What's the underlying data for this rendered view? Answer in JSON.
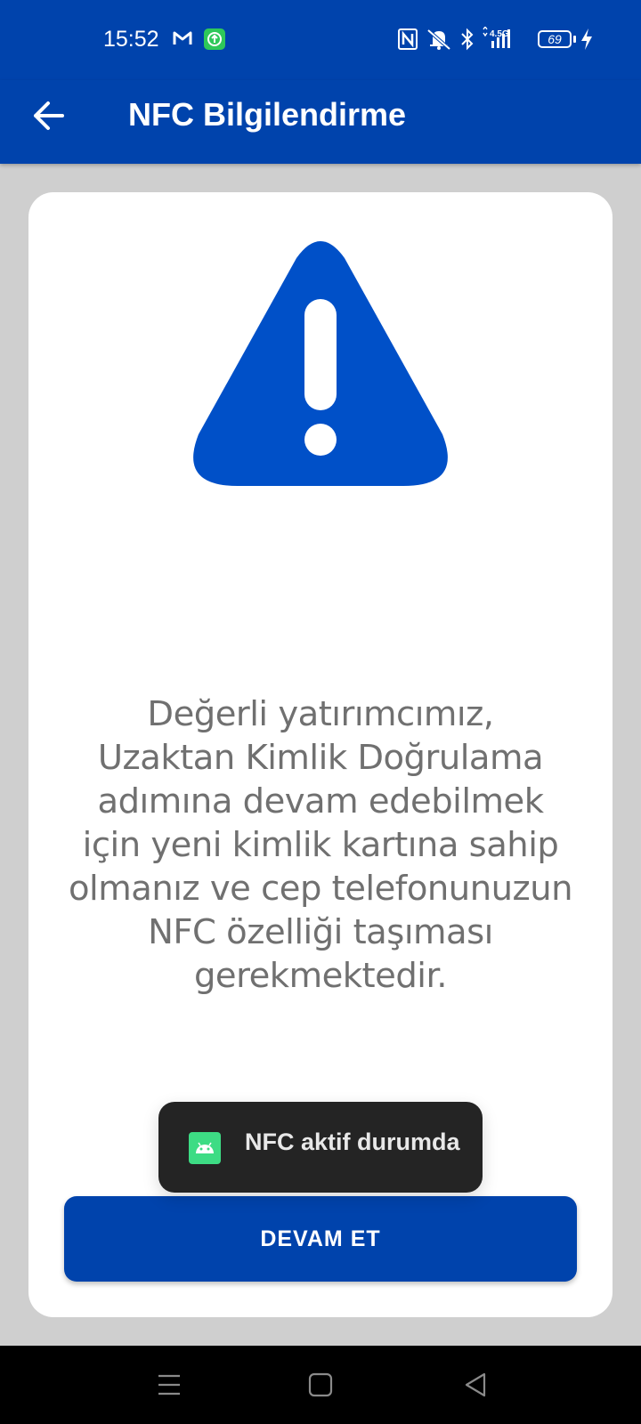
{
  "status_bar": {
    "time": "15:52",
    "network_label": "4.5G",
    "battery_level": "69",
    "icons": [
      "gmail-icon",
      "upload-notification-icon",
      "nfc-icon",
      "mute-icon",
      "bluetooth-icon",
      "signal-icon",
      "battery-icon",
      "charging-icon"
    ]
  },
  "app_bar": {
    "title": "NFC Bilgilendirme",
    "back_icon": "arrow-back-icon"
  },
  "content": {
    "warning_icon": "warning-triangle-icon",
    "message_lines": [
      "Değerli yatırımcımız,",
      "Uzaktan Kimlik Doğrulama",
      "adımına devam edebilmek",
      "için yeni kimlik kartına sahip",
      "olmanız ve cep telefonunuzun",
      "NFC özelliği taşıması",
      "gerekmektedir."
    ],
    "continue_label": "DEVAM ET"
  },
  "toast": {
    "icon": "android-icon",
    "text": "NFC aktif durumda"
  },
  "nav_bar": {
    "icons": [
      "menu-icon",
      "home-icon",
      "back-triangle-icon"
    ]
  },
  "colors": {
    "primary": "#0043ac",
    "warning": "#0050c8",
    "background": "#cfcfcf",
    "message_text": "#707070",
    "toast_bg": "#242424",
    "toast_icon": "#3ddc84"
  }
}
